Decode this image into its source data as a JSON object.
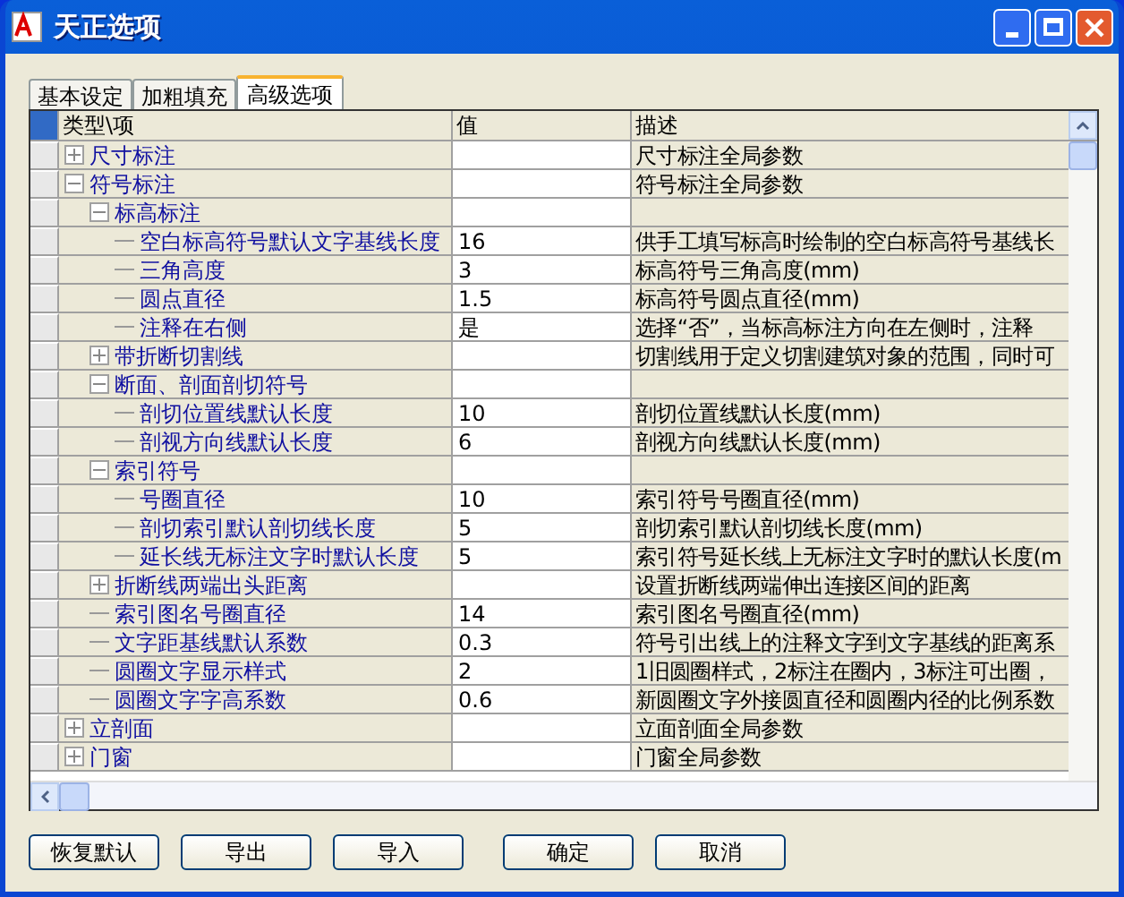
{
  "window": {
    "title": "天正选项"
  },
  "tabs": [
    {
      "label": "基本设定",
      "selected": false
    },
    {
      "label": "加粗填充",
      "selected": false
    },
    {
      "label": "高级选项",
      "selected": true
    }
  ],
  "grid": {
    "columns": [
      "类型\\项",
      "值",
      "描述"
    ],
    "rows": [
      {
        "name": "尺寸标注",
        "description": "尺寸标注全局参数",
        "expanded": false
      },
      {
        "name": "符号标注",
        "description": "符号标注全局参数",
        "expanded": true,
        "children": [
          {
            "name": "标高标注",
            "expanded": true,
            "children": [
              {
                "name": "空白标高符号默认文字基线长度",
                "value": "16",
                "description": "供手工填写标高时绘制的空白标高符号基线长"
              },
              {
                "name": "三角高度",
                "value": "3",
                "description": "标高符号三角高度(mm)"
              },
              {
                "name": "圆点直径",
                "value": "1.5",
                "description": "标高符号圆点直径(mm)"
              },
              {
                "name": "注释在右侧",
                "value": "是",
                "description": "选择“否”，当标高标注方向在左侧时，注释"
              }
            ]
          },
          {
            "name": "带折断切割线",
            "description": "切割线用于定义切割建筑对象的范围，同时可",
            "expanded": false
          },
          {
            "name": "断面、剖面剖切符号",
            "expanded": true,
            "children": [
              {
                "name": "剖切位置线默认长度",
                "value": "10",
                "description": "剖切位置线默认长度(mm)"
              },
              {
                "name": "剖视方向线默认长度",
                "value": "6",
                "description": "剖视方向线默认长度(mm)"
              }
            ]
          },
          {
            "name": "索引符号",
            "expanded": true,
            "children": [
              {
                "name": "号圈直径",
                "value": "10",
                "description": "索引符号号圈直径(mm)"
              },
              {
                "name": "剖切索引默认剖切线长度",
                "value": "5",
                "description": "剖切索引默认剖切线长度(mm)"
              },
              {
                "name": "延长线无标注文字时默认长度",
                "value": "5",
                "description": "索引符号延长线上无标注文字时的默认长度(m"
              }
            ]
          },
          {
            "name": "折断线两端出头距离",
            "description": "设置折断线两端伸出连接区间的距离",
            "expanded": false
          },
          {
            "name": "索引图名号圈直径",
            "value": "14",
            "description": "索引图名号圈直径(mm)"
          },
          {
            "name": "文字距基线默认系数",
            "value": "0.3",
            "description": "符号引出线上的注释文字到文字基线的距离系"
          },
          {
            "name": "圆圈文字显示样式",
            "value": "2",
            "description": "1旧圆圈样式，2标注在圈内，3标注可出圈，"
          },
          {
            "name": "圆圈文字字高系数",
            "value": "0.6",
            "description": "新圆圈文字外接圆直径和圆圈内径的比例系数"
          }
        ]
      },
      {
        "name": "立剖面",
        "description": "立面剖面全局参数",
        "expanded": false
      },
      {
        "name": "门窗",
        "description": "门窗全局参数",
        "expanded": false
      }
    ]
  },
  "buttons": [
    "恢复默认",
    "导出",
    "导入",
    "确定",
    "取消"
  ]
}
